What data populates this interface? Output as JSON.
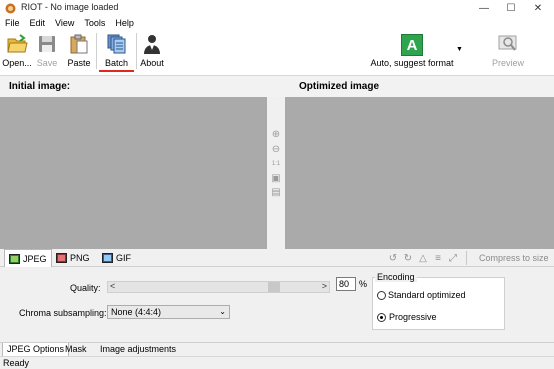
{
  "window": {
    "title": "RIOT - No image loaded",
    "controls": [
      "minimize-icon",
      "maximize-icon",
      "close-icon"
    ]
  },
  "menu": [
    "File",
    "Edit",
    "View",
    "Tools",
    "Help"
  ],
  "toolbar": {
    "open": "Open...",
    "save": "Save",
    "paste": "Paste",
    "batch": "Batch",
    "about": "About",
    "auto_format": "Auto, suggest format",
    "auto_format_badge": "A",
    "preview": "Preview",
    "accent_color": "#e0281e"
  },
  "panes": {
    "initial_title": "Initial image:",
    "optimized_title": "Optimized image"
  },
  "zoom_tools": {
    "one_to_one": "1:1"
  },
  "format_tabs": [
    "JPEG",
    "PNG",
    "GIF"
  ],
  "compress_to_size": "Compress to size",
  "options": {
    "quality_label": "Quality:",
    "quality_value": "80",
    "quality_unit": "%",
    "quality_level": 0.8,
    "chroma_label": "Chroma subsampling:",
    "chroma_value": "None (4:4:4)",
    "encoding_title": "Encoding",
    "encoding_standard": "Standard optimized",
    "encoding_progressive": "Progressive",
    "slider_left": "<",
    "slider_right": ">"
  },
  "bottom_tabs": [
    "JPEG Options",
    "Mask",
    "Image adjustments"
  ],
  "status": "Ready"
}
